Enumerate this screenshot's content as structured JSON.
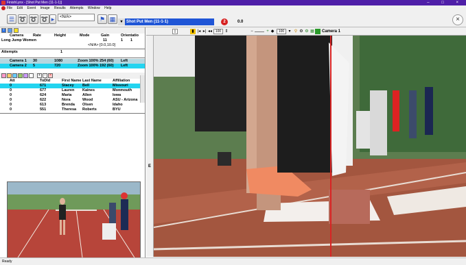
{
  "window": {
    "title": "FinishLynx - [Shot Put Men (11-1-1)]",
    "buttons": "– □ ×"
  },
  "menu": [
    "File",
    "Edit",
    "Event",
    "Image",
    "Results",
    "Attempts",
    "Window",
    "Help"
  ],
  "toolbar": {
    "na_value": "<N/A>",
    "event_name": "Shot Put Men (11-1-1)",
    "event_number_badge": "2",
    "time_value": "0.0",
    "close_glyph": "×"
  },
  "event_grid": {
    "headers": [
      "Camera",
      "Rate",
      "Height",
      "Mode",
      "Gain",
      "Orientatio"
    ],
    "event_row": {
      "name": "Long Jump Women",
      "gain": "11",
      "c1": "1",
      "c2": "1"
    },
    "na_line": "<N/A> [0.0,10.0]",
    "attempts_label": "Attempts",
    "attempts_value": "1",
    "cameras": [
      {
        "camera": "Camera 1",
        "rate": "30",
        "height": "1080",
        "mode": "Zoom 100% 254 (60)",
        "orient": "Left"
      },
      {
        "camera": "Camera 2",
        "rate": "5",
        "height": "720",
        "mode": "Zoom 100% 192 (60)",
        "orient": "Left"
      }
    ]
  },
  "athletes": {
    "headers": [
      "Att",
      "ToDId",
      "First Name",
      "Last Name",
      "Affiliation"
    ],
    "rows": [
      {
        "att": "0",
        "id": "671",
        "first": "Stacey",
        "last": "Bell",
        "aff": "Missouri"
      },
      {
        "att": "0",
        "id": "677",
        "first": "Lauren",
        "last": "Kaines",
        "aff": "Monmouth"
      },
      {
        "att": "0",
        "id": "624",
        "first": "Maria",
        "last": "Allen",
        "aff": "Iowa"
      },
      {
        "att": "0",
        "id": "622",
        "first": "Nora",
        "last": "Wood",
        "aff": "ASU - Arizona"
      },
      {
        "att": "0",
        "id": "613",
        "first": "Brenda",
        "last": "Olsen",
        "aff": "Idaho"
      },
      {
        "att": "0",
        "id": "551",
        "first": "Theresa",
        "last": "Roberts",
        "aff": "BYU"
      }
    ]
  },
  "video_toolbar": {
    "frame_value": "100",
    "zoom_value": "100",
    "camera_label": "Camera 1"
  },
  "splitter_label": "E",
  "status": "Ready",
  "colors": {
    "titlebar": "#4f1fa8",
    "selection": "#22d4f0",
    "event_field": "#1f55d6"
  }
}
